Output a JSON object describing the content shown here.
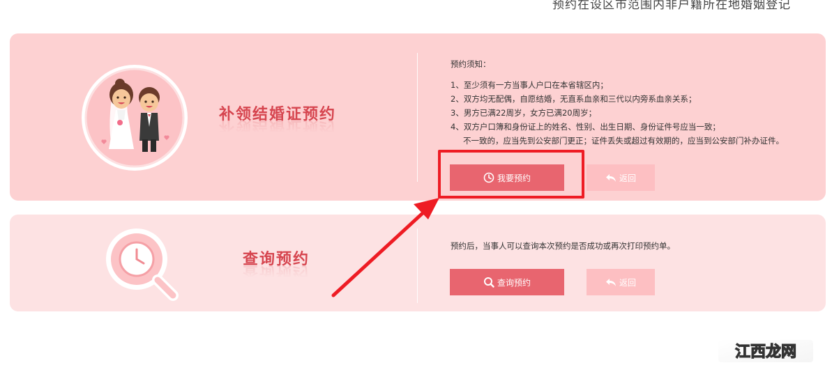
{
  "header": {
    "top_note": "预约在设区市范围内非户籍所在地婚姻登记"
  },
  "reissue": {
    "title": "补领结婚证预约",
    "notice_title": "预约须知：",
    "notice_items": [
      "1、至少须有一方当事人户口在本省辖区内；",
      "2、双方均无配偶，自愿结婚，无直系血亲和三代以内旁系血亲关系；",
      "3、男方已满22周岁，女方已满20周岁；",
      "4、双方户口簿和身份证上的姓名、性别、出生日期、身份证件号应当一致；"
    ],
    "notice_continuation": "不一致的，应当先到公安部门更正；证件丢失或超过有效期的，应当到公安部门补办证件。",
    "primary_button": "我要预约",
    "back_button": "返回",
    "primary_icon": "clock-icon",
    "back_icon": "return-arrow-icon"
  },
  "query": {
    "title": "查询预约",
    "description": "预约后，当事人可以查询本次预约是否成功或再次打印预约单。",
    "primary_button": "查询预约",
    "back_button": "返回",
    "primary_icon": "search-icon",
    "back_icon": "return-arrow-icon"
  },
  "annotation": {
    "color": "#ee1c24"
  },
  "watermark": {
    "text": "江西龙网",
    "logo": "jiangxi-longwang-logo"
  },
  "colors": {
    "panel_primary_bg": "#fdd1d2",
    "panel_secondary_bg": "#fde2e3",
    "button_primary": "#e8656f",
    "button_back": "#fdbfc2",
    "title_red": "#d6454f"
  }
}
